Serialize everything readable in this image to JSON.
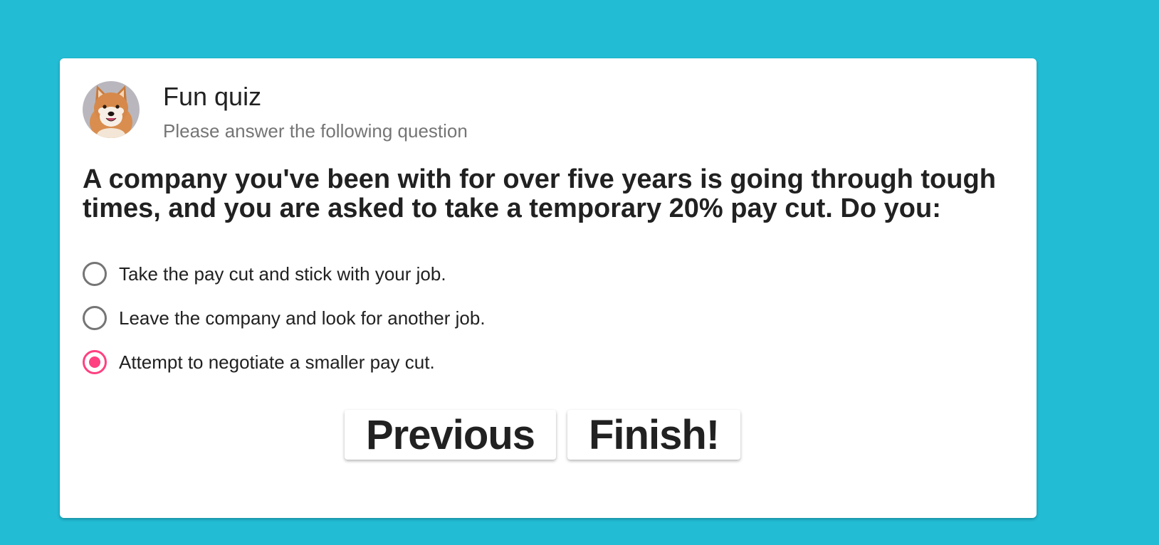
{
  "header": {
    "title": "Fun quiz",
    "subtitle": "Please answer the following question",
    "avatar": "shiba-inu-dog"
  },
  "question": "A company you've been with for over five years is going through tough times, and you are asked to take a temporary 20% pay cut. Do you:",
  "options": [
    {
      "label": "Take the pay cut and stick with your job.",
      "checked": false
    },
    {
      "label": "Leave the company and look for another job.",
      "checked": false
    },
    {
      "label": "Attempt to negotiate a smaller pay cut.",
      "checked": true
    }
  ],
  "buttons": {
    "previous": "Previous",
    "finish": "Finish!"
  },
  "colors": {
    "background": "#22bcd4",
    "accent": "#ff4081",
    "radio_unchecked": "#757575"
  }
}
